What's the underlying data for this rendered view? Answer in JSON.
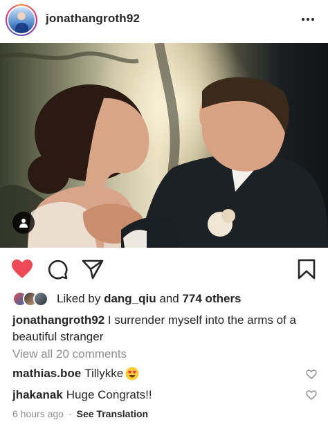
{
  "post": {
    "username": "jonathangroth92",
    "likes": {
      "prefix": "Liked by",
      "user": "dang_qiu",
      "joiner": "and",
      "others": "774 others"
    },
    "caption": {
      "user": "jonathangroth92",
      "text": "I surrender myself into the arms of a beautiful stranger"
    },
    "view_comments": "View all 20 comments",
    "comments": [
      {
        "user": "mathias.boe",
        "text": "Tillykke",
        "emoji": "heart-eyes-emoji"
      },
      {
        "user": "jhakanak",
        "text": "Huge Congrats!!"
      }
    ],
    "timestamp": "6 hours ago",
    "separator": "·",
    "see_translation": "See Translation"
  },
  "colors": {
    "like_red": "#ed4956",
    "text": "#262626",
    "muted": "#8e8e8e"
  },
  "icons": [
    "more-icon",
    "user-tag-icon",
    "heart-icon",
    "comment-icon",
    "share-icon",
    "bookmark-icon",
    "comment-like-icon"
  ]
}
